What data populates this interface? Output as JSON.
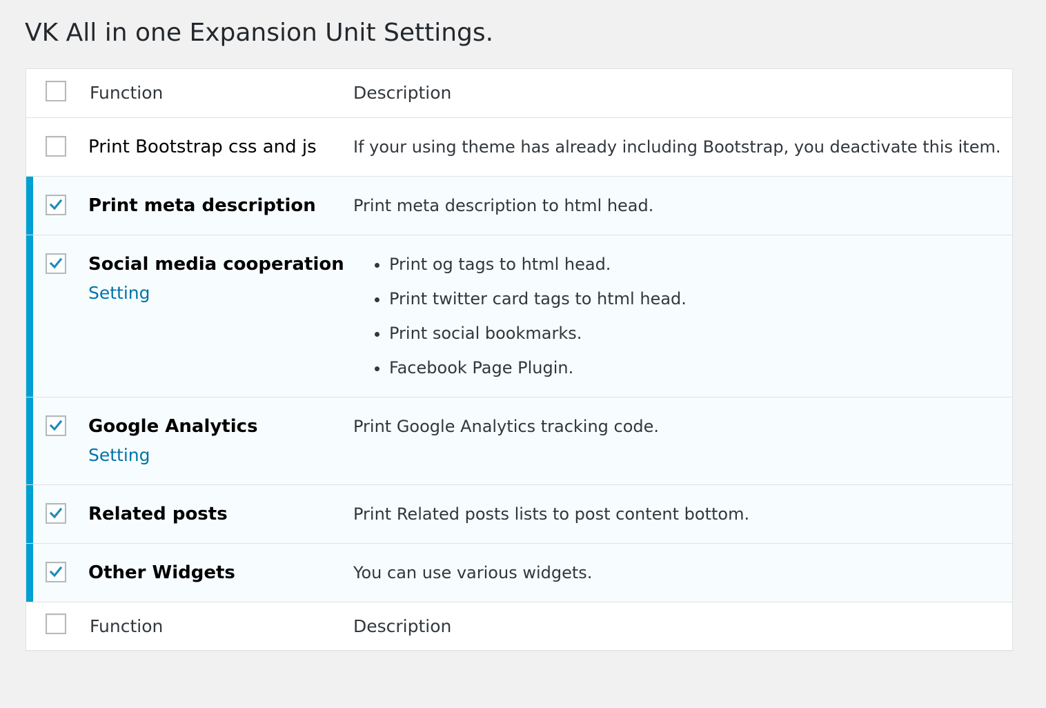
{
  "page": {
    "title": "VK All in one Expansion Unit Settings."
  },
  "table": {
    "header": {
      "function_label": "Function",
      "description_label": "Description"
    },
    "footer": {
      "function_label": "Function",
      "description_label": "Description"
    },
    "rows": [
      {
        "name": "Print Bootstrap css and js",
        "checked": false,
        "description": "If your using theme has already including Bootstrap, you deactivate this item."
      },
      {
        "name": "Print meta description",
        "checked": true,
        "description": "Print meta description to html head."
      },
      {
        "name": "Social media cooperation",
        "checked": true,
        "setting_label": "Setting",
        "description_items": [
          "Print og tags to html head.",
          "Print twitter card tags to html head.",
          "Print social bookmarks.",
          "Facebook Page Plugin."
        ]
      },
      {
        "name": "Google Analytics",
        "checked": true,
        "setting_label": "Setting",
        "description": "Print Google Analytics tracking code."
      },
      {
        "name": "Related posts",
        "checked": true,
        "description": "Print Related posts lists to post content bottom."
      },
      {
        "name": "Other Widgets",
        "checked": true,
        "description": "You can use various widgets."
      }
    ]
  },
  "colors": {
    "accent": "#00a0d2",
    "link": "#0073aa",
    "active_row_bg": "#f7fcfe",
    "check": "#1e8cbe"
  },
  "icons": {
    "checkmark": "checkmark-icon"
  }
}
